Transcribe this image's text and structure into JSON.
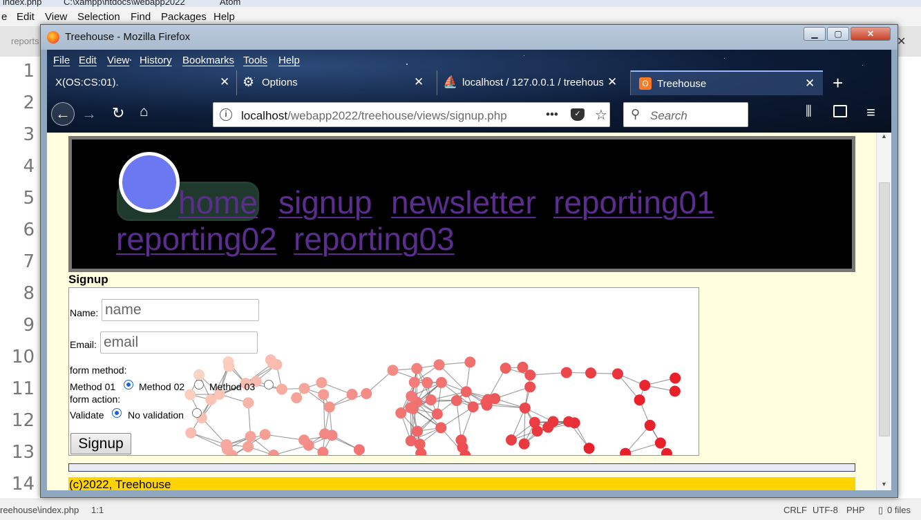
{
  "atom": {
    "title_file": "index.php",
    "title_path": "C:\\xampp\\htdocs\\webapp2022",
    "title_app": "Atom",
    "menu": [
      "e",
      "Edit",
      "View",
      "Selection",
      "Find",
      "Packages",
      "Help"
    ],
    "tab_label": "reports",
    "line_numbers": [
      "1",
      "2",
      "3",
      "4",
      "5",
      "6",
      "7",
      "8",
      "9",
      "10",
      "11",
      "12",
      "13",
      "14"
    ],
    "status": {
      "path": "reehouse\\index.php",
      "cursor": "1:1",
      "line_ending": "CRLF",
      "encoding": "UTF-8",
      "grammar": "PHP",
      "files": "0 files"
    }
  },
  "firefox": {
    "window_title": "Treehouse - Mozilla Firefox",
    "menu": [
      "File",
      "Edit",
      "View",
      "History",
      "Bookmarks",
      "Tools",
      "Help"
    ],
    "tabs": [
      {
        "label": "X(OS:CS:01).",
        "icon": "none",
        "active": false
      },
      {
        "label": "Options",
        "icon": "gear-icon",
        "active": false
      },
      {
        "label": "localhost / 127.0.0.1 / treehouse",
        "icon": "phpmyadmin-icon",
        "active": false
      },
      {
        "label": "Treehouse",
        "icon": "xampp-icon",
        "active": true
      }
    ],
    "url_host": "localhost",
    "url_path": "/webapp2022/treehouse/views/signup.php",
    "search_placeholder": "Search",
    "page_actions": "•••"
  },
  "page": {
    "nav": [
      "home",
      "signup",
      "newsletter",
      "reporting01",
      "reporting02",
      "reporting03"
    ],
    "heading": "Signup",
    "form": {
      "name_label": "Name:",
      "name_placeholder": "name",
      "email_label": "Email:",
      "email_placeholder": "email",
      "method_heading": "form method:",
      "method_options": [
        "Method 01",
        "Method 02",
        "Method 03"
      ],
      "method_selected": "Method 01",
      "action_heading": "form action:",
      "action_options": [
        "Validate",
        "No validation"
      ],
      "action_selected": "Validate",
      "submit_label": "Signup"
    },
    "footer": "(c)2022, Treehouse"
  },
  "colors": {
    "page_bg": "#ffffe0",
    "header_bg": "#000000",
    "nav_link": "#5b2d8e",
    "logo_circle": "#6c78f2",
    "footer_bg": "#ffd400",
    "network_node_light": "#fcd9c8",
    "network_node_dark": "#e8202a"
  }
}
